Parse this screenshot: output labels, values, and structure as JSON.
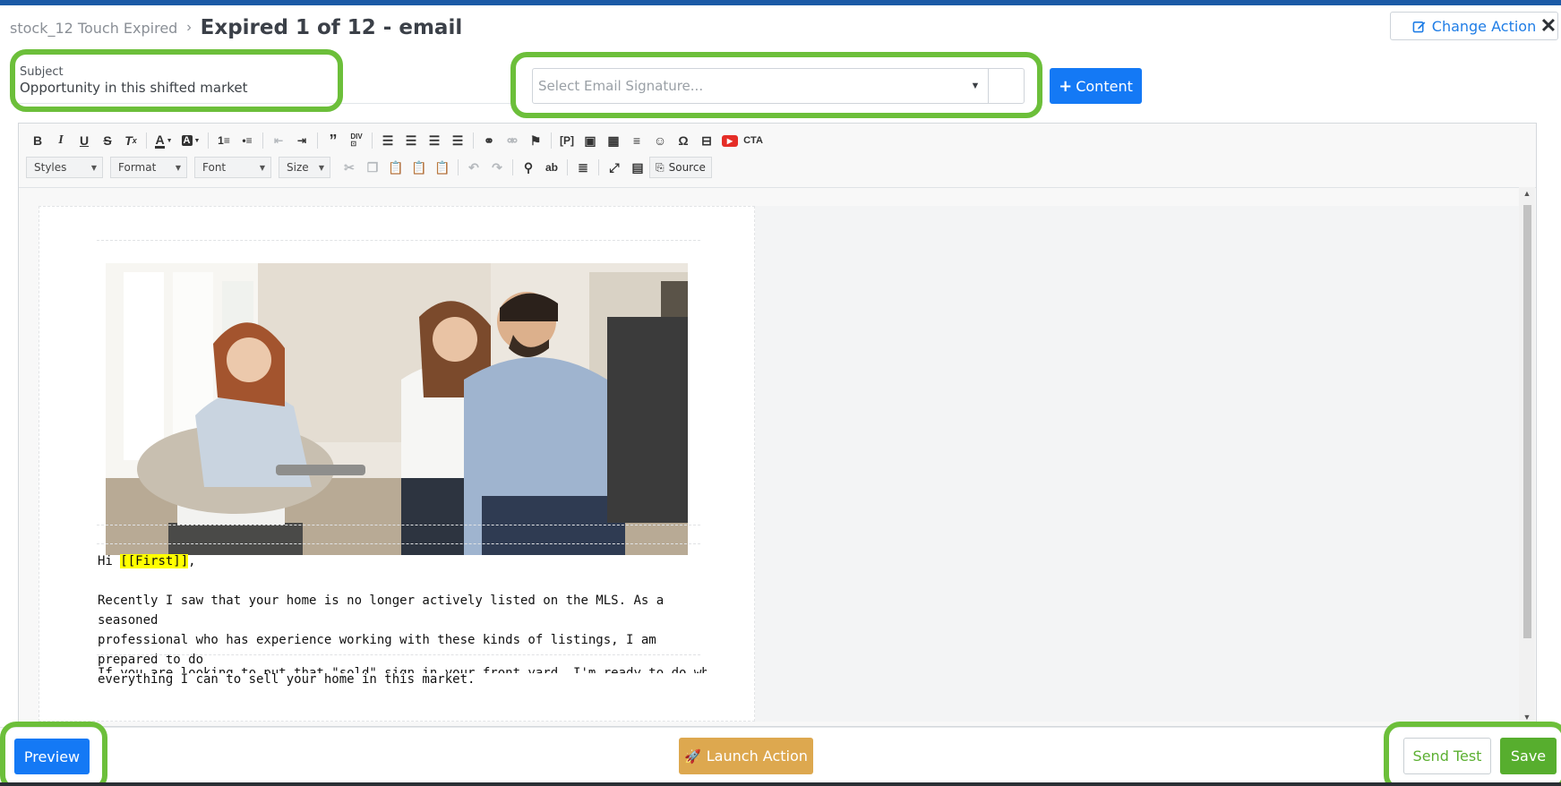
{
  "header": {
    "breadcrumb": "stock_12 Touch Expired",
    "breadcrumb_separator": "›",
    "title": "Expired 1 of 12 - email",
    "change_action_label": "Change Action",
    "close_glyph": "✕"
  },
  "subject": {
    "label": "Subject",
    "value": "Opportunity in this shifted market"
  },
  "signature": {
    "placeholder": "Select Email Signature..."
  },
  "content_button": {
    "label": "Content",
    "icon": "plus-icon"
  },
  "toolbar": {
    "row1_icons": [
      "bold-icon",
      "italic-icon",
      "underline-icon",
      "strikethrough-icon",
      "remove-format-icon",
      "text-color-icon",
      "background-color-icon",
      "numbered-list-icon",
      "bulleted-list-icon",
      "decrease-indent-icon",
      "increase-indent-icon",
      "blockquote-icon",
      "create-div-icon",
      "align-left-icon",
      "align-center-icon",
      "align-right-icon",
      "justify-icon",
      "link-icon",
      "unlink-icon",
      "anchor-icon",
      "placeholder-icon",
      "image-icon",
      "table-icon",
      "horizontal-line-icon",
      "smiley-icon",
      "special-char-icon",
      "youtube-icon",
      "cta-icon"
    ],
    "combos": [
      "Styles",
      "Format",
      "Font",
      "Size"
    ],
    "source_label": "Source",
    "cta_label": "CTA"
  },
  "email_body": {
    "greeting_prefix": "Hi ",
    "merge_field": "[[First]]",
    "greeting_suffix": ",",
    "paragraph1_lines": [
      "Recently I saw that your home is no longer actively listed on the MLS. As a seasoned",
      "professional who has experience working with these kinds of listings, I am prepared to do",
      "everything I can to sell your home in this market."
    ],
    "paragraph2_partial": "If you are looking to put that \"sold\" sign in your front yard, I'm ready to do what it takes to"
  },
  "footer": {
    "preview_label": "Preview",
    "launch_label": "Launch Action",
    "send_test_label": "Send Test",
    "save_label": "Save"
  },
  "colors": {
    "primary": "#1479f5",
    "highlight_ring": "#6cbf3a",
    "launch": "#dda84f",
    "save": "#57ae2e"
  }
}
